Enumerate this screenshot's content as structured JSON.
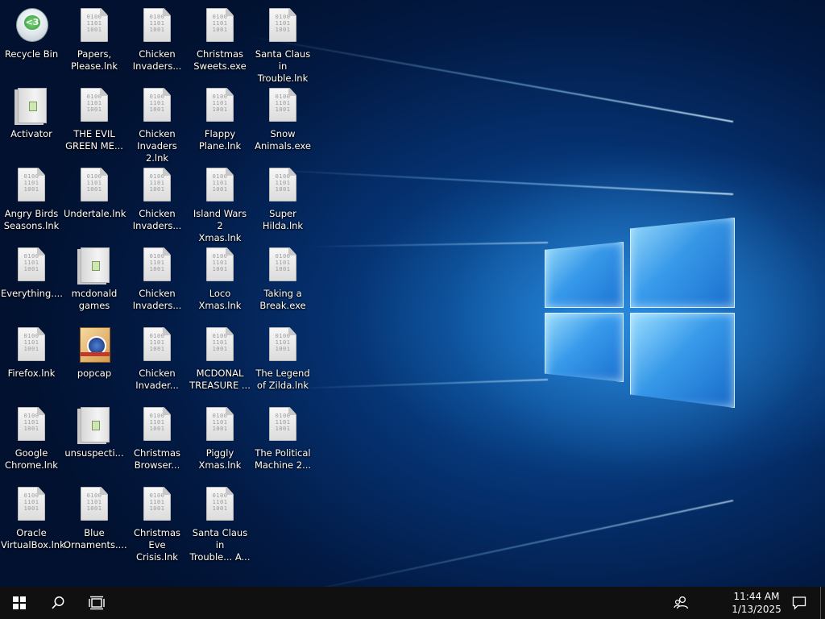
{
  "desktop": {
    "icons": [
      {
        "label": "Recycle Bin",
        "icon": "recycle-bin-icon",
        "type": "bin"
      },
      {
        "label": "Activator",
        "icon": "folder-icon",
        "type": "folder"
      },
      {
        "label": "Angry Birds\nSeasons.lnk",
        "icon": "file-icon",
        "type": "file"
      },
      {
        "label": "Everything....",
        "icon": "file-icon",
        "type": "file"
      },
      {
        "label": "Firefox.lnk",
        "icon": "file-icon",
        "type": "file"
      },
      {
        "label": "Google\nChrome.lnk",
        "icon": "file-icon",
        "type": "file"
      },
      {
        "label": "Oracle\nVirtualBox.lnk",
        "icon": "file-icon",
        "type": "file"
      },
      {
        "label": "Papers,\nPlease.lnk",
        "icon": "file-icon",
        "type": "file"
      },
      {
        "label": "THE EVIL\nGREEN ME...",
        "icon": "file-icon",
        "type": "file"
      },
      {
        "label": "Undertale.lnk",
        "icon": "file-icon",
        "type": "file"
      },
      {
        "label": "mcdonald\ngames",
        "icon": "folder-icon",
        "type": "folder"
      },
      {
        "label": "popcap",
        "icon": "popcap-icon",
        "type": "popcap"
      },
      {
        "label": "unsuspecti...",
        "icon": "folder-icon",
        "type": "folder"
      },
      {
        "label": "Blue\nOrnaments....",
        "icon": "file-icon",
        "type": "file"
      },
      {
        "label": "Chicken\nInvaders...",
        "icon": "file-icon",
        "type": "file"
      },
      {
        "label": "Chicken\nInvaders 2.lnk",
        "icon": "file-icon",
        "type": "file"
      },
      {
        "label": "Chicken\nInvaders...",
        "icon": "file-icon",
        "type": "file"
      },
      {
        "label": "Chicken\nInvaders...",
        "icon": "file-icon",
        "type": "file"
      },
      {
        "label": "Chicken\nInvader...",
        "icon": "file-icon",
        "type": "file"
      },
      {
        "label": "Christmas\nBrowser...",
        "icon": "file-icon",
        "type": "file"
      },
      {
        "label": "Christmas Eve\nCrisis.lnk",
        "icon": "file-icon",
        "type": "file"
      },
      {
        "label": "Christmas\nSweets.exe",
        "icon": "file-icon",
        "type": "file"
      },
      {
        "label": "Flappy\nPlane.lnk",
        "icon": "file-icon",
        "type": "file"
      },
      {
        "label": "Island Wars 2\nXmas.lnk",
        "icon": "file-icon",
        "type": "file"
      },
      {
        "label": "Loco\nXmas.lnk",
        "icon": "file-icon",
        "type": "file"
      },
      {
        "label": "MCDONAL\nTREASURE ...",
        "icon": "file-icon",
        "type": "file"
      },
      {
        "label": "Piggly\nXmas.lnk",
        "icon": "file-icon",
        "type": "file"
      },
      {
        "label": "Santa Claus in\nTrouble... A...",
        "icon": "file-icon",
        "type": "file"
      },
      {
        "label": "Santa Claus in\nTrouble.lnk",
        "icon": "file-icon",
        "type": "file"
      },
      {
        "label": "Snow\nAnimals.exe",
        "icon": "file-icon",
        "type": "file"
      },
      {
        "label": "Super\nHilda.lnk",
        "icon": "file-icon",
        "type": "file"
      },
      {
        "label": "Taking a\nBreak.exe",
        "icon": "file-icon",
        "type": "file"
      },
      {
        "label": "The Legend\nof Zilda.lnk",
        "icon": "file-icon",
        "type": "file"
      },
      {
        "label": "The Political\nMachine 2...",
        "icon": "file-icon",
        "type": "file"
      }
    ]
  },
  "taskbar": {
    "start_icon": "windows-logo-icon",
    "search_icon": "search-icon",
    "taskview_icon": "task-view-icon",
    "people_icon": "people-icon",
    "notification_icon": "action-center-icon",
    "time": "11:44 AM",
    "date": "1/13/2025"
  },
  "colors": {
    "taskbar_bg": "#101010",
    "wallpaper_blue": "#0c58a8"
  }
}
